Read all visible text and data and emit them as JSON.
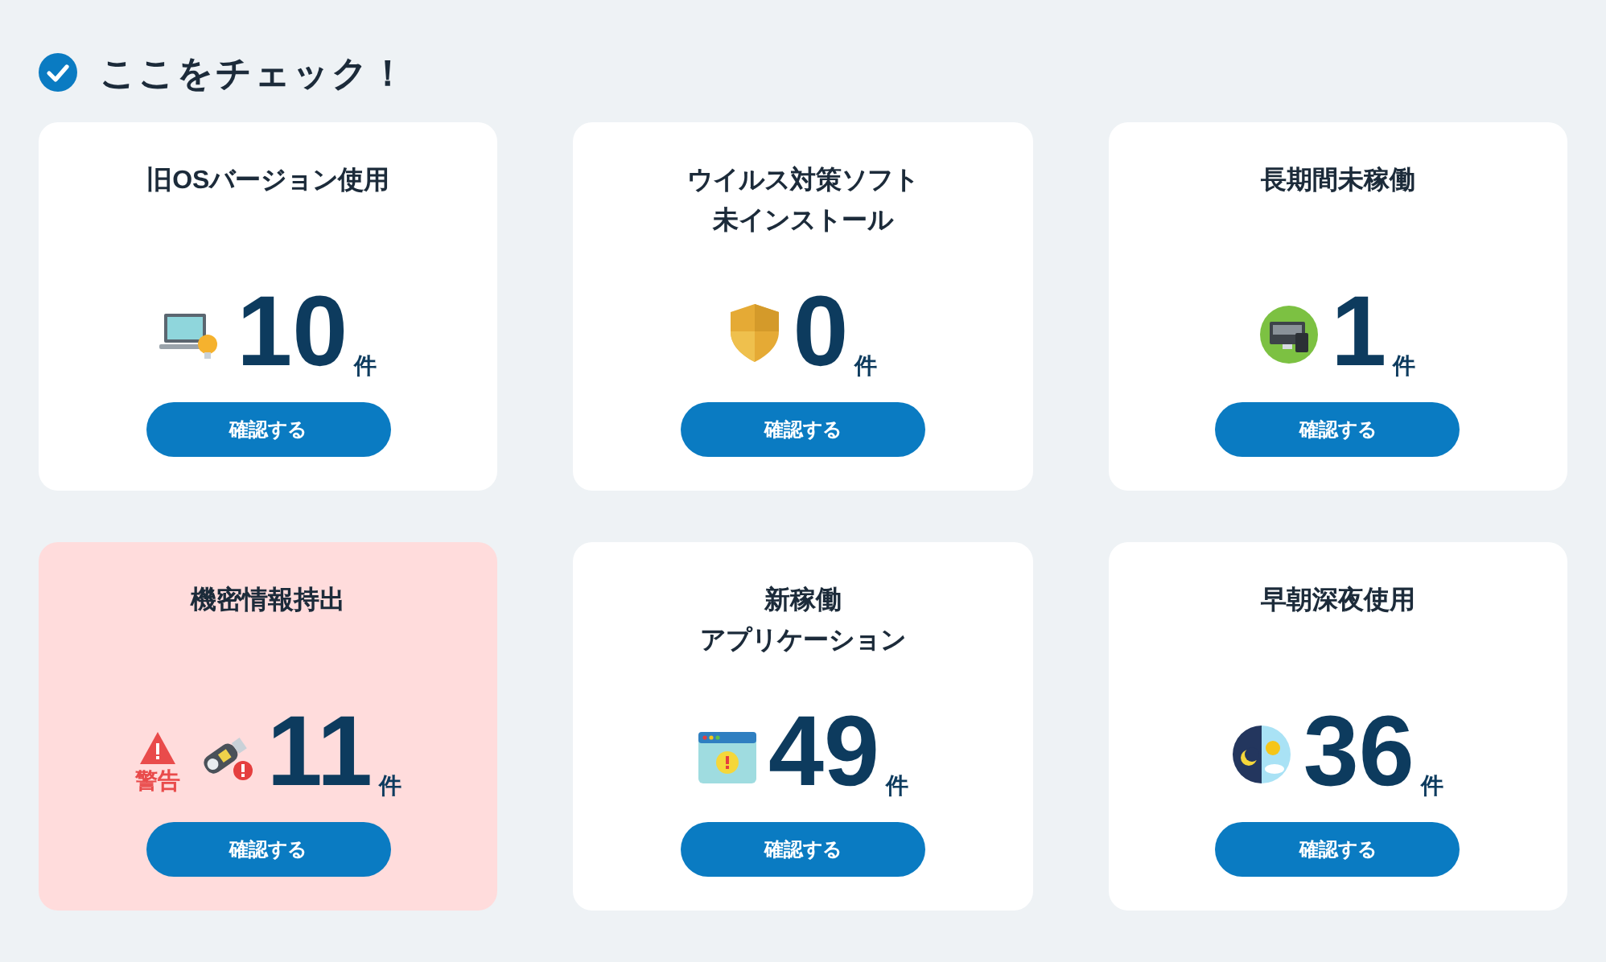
{
  "heading": "ここをチェック！",
  "cards": [
    {
      "title_lines": [
        "旧OSバージョン使用"
      ],
      "kind": "laptop",
      "count": "10",
      "unit": "件",
      "button": "確認する",
      "alert": false
    },
    {
      "title_lines": [
        "ウイルス対策ソフト",
        "未インストール"
      ],
      "kind": "shield",
      "count": "0",
      "unit": "件",
      "button": "確認する",
      "alert": false
    },
    {
      "title_lines": [
        "長期間未稼働"
      ],
      "kind": "monitor",
      "count": "1",
      "unit": "件",
      "button": "確認する",
      "alert": false
    },
    {
      "title_lines": [
        "機密情報持出"
      ],
      "kind": "usb",
      "count": "11",
      "unit": "件",
      "button": "確認する",
      "alert": true,
      "warning_label": "警告"
    },
    {
      "title_lines": [
        "新稼働",
        "アプリケーション"
      ],
      "kind": "window",
      "count": "49",
      "unit": "件",
      "button": "確認する",
      "alert": false
    },
    {
      "title_lines": [
        "早朝深夜使用"
      ],
      "kind": "daynight",
      "count": "36",
      "unit": "件",
      "button": "確認する",
      "alert": false
    }
  ]
}
